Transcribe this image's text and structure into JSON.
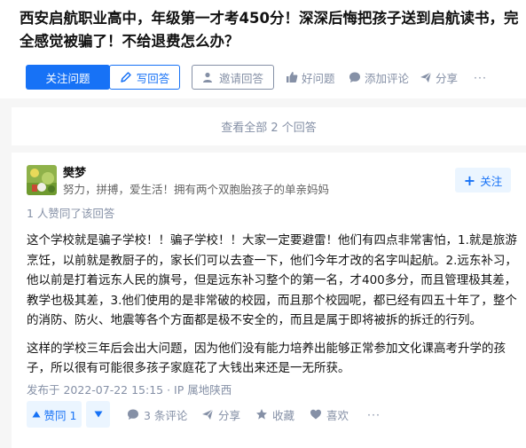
{
  "question": {
    "title": "西安启航职业高中，年级第一才考450分！深深后悔把孩子送到启航读书，完全感觉被骗了！不给退费怎么办？"
  },
  "actions": {
    "follow_question": "关注问题",
    "write_answer": "写回答",
    "invite_answer": "邀请回答",
    "good_question": "好问题",
    "add_comment": "添加评论",
    "share": "分享",
    "more": "···"
  },
  "view_all": "查看全部 2 个回答",
  "answer": {
    "author": {
      "name": "樊梦",
      "bio": "努力，拼搏，爱生活！拥有两个双胞胎孩子的单亲妈妈",
      "follow_label": "关注"
    },
    "upvote_summary": "1 人赞同了该回答",
    "paragraphs": [
      "这个学校就是骗子学校！！骗子学校！！大家一定要避雷！他们有四点非常害怕，1.就是旅游烹饪，以前就是教厨子的，家长们可以去查一下，他们今年才改的名字叫起航。2.远东补习，他以前是打着远东人民的旗号，但是远东补习整个的第一名，才400多分，而且管理极其差，教学也极其差，3.他们使用的是非常破的校园，而且那个校园呢，都已经有四五十年了，整个的消防、防火、地震等各个方面都是极不安全的，而且是属于即将被拆的拆迁的行列。",
      "这样的学校三年后会出大问题，因为他们没有能力培养出能够正常参加文化课高考升学的孩子，所以很有可能很多孩子家庭花了大钱出来还是一无所获。"
    ],
    "meta": "发布于 2022-07-22 15:15 · IP 属地陕西",
    "footer": {
      "upvote": "赞同 1",
      "comments": "3 条评论",
      "share": "分享",
      "favorite": "收藏",
      "like": "喜欢",
      "more": "···"
    }
  },
  "colors": {
    "accent": "#1772f6",
    "muted": "#8590a6",
    "accent_light": "#ebf5ff"
  }
}
